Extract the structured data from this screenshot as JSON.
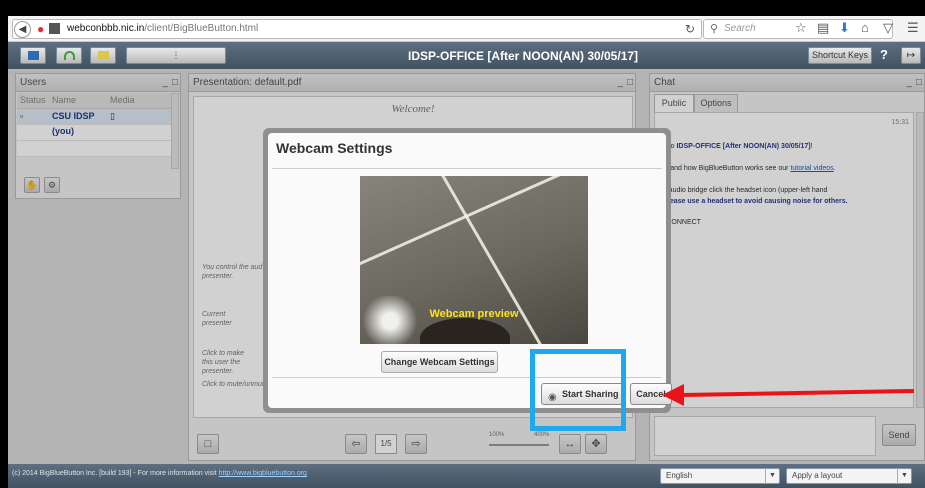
{
  "browser": {
    "url_host": "webconbbb.nic.in",
    "url_path": "/client/BigBlueButton.html",
    "search_placeholder": "Search"
  },
  "header": {
    "title": "IDSP-OFFICE [After NOON(AN) 30/05/17]",
    "shortcut_keys_label": "Shortcut Keys",
    "help_label": "?"
  },
  "users": {
    "title": "Users",
    "columns": [
      "Status",
      "Name",
      "Media"
    ],
    "rows": [
      {
        "name": "CSU IDSP (you)"
      }
    ]
  },
  "presentation": {
    "title": "Presentation: default.pdf",
    "welcome": "Welcome!",
    "text_control": "You control the aud",
    "text_presenter": "presenter.",
    "text_current": "Current",
    "text_current2": "presenter",
    "text_click1": "Click to make",
    "text_click2": "this user the",
    "text_click3": "presenter.",
    "text_click4": "Click to mute/unmut",
    "page_label": "1/5",
    "zoom_min": "100%",
    "zoom_max": "400%"
  },
  "chat": {
    "title": "Chat",
    "tabs": [
      "Public",
      "Options"
    ],
    "time": "15:31",
    "msg1_pre": "me to ",
    "msg1_bold": "IDSP-OFFICE [After NOON(AN) 30/05/17]",
    "msg1_post": "!",
    "msg2_pre": "lerstand how BigBlueButton works see our ",
    "msg2_link": "tutorial videos",
    "msg2_post": ".",
    "msg3": "the audio bridge click the headset icon (upper-left hand",
    "msg4_bold": "). Please use a headset to avoid causing noise for others.",
    "msg5": "EBCONNECT",
    "send_label": "Send"
  },
  "footer": {
    "text": "(c) 2014 BigBlueButton Inc. [build 193] - For more information visit ",
    "link": "http://www.bigbluebutton.org",
    "language": "English",
    "layout": "Apply a layout"
  },
  "modal": {
    "title": "Webcam Settings",
    "preview_label": "Webcam preview",
    "change_label": "Change Webcam Settings",
    "start_label": "Start Sharing",
    "cancel_label": "Cancel"
  },
  "colors": {
    "highlight": "#1fa9ea",
    "arrow": "#e8141a",
    "header_bg": "#4d5e6e",
    "preview_label": "#ffe21f"
  }
}
